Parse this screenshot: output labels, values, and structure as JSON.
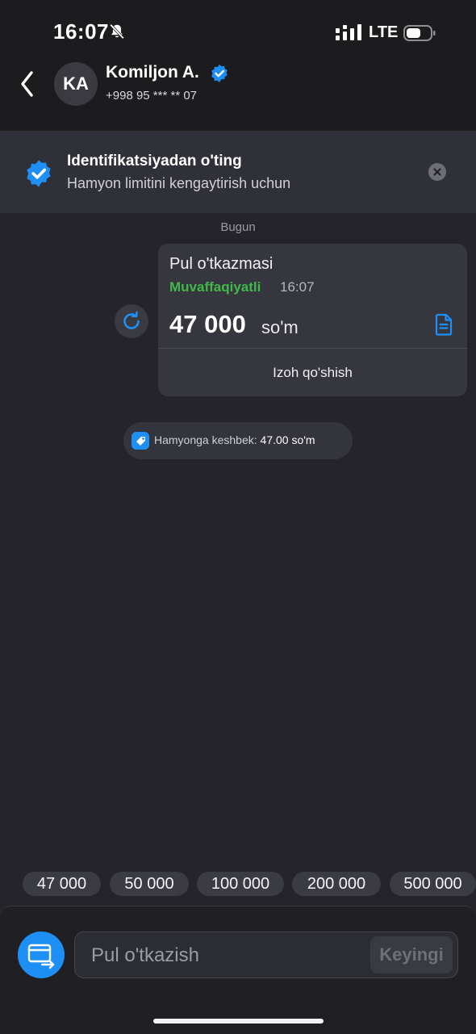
{
  "status_bar": {
    "time": "16:07",
    "network": "LTE",
    "icons": [
      "bell-off-icon",
      "signal-icon",
      "battery-icon"
    ]
  },
  "header": {
    "avatar_initials": "KA",
    "name": "Komiljon A.",
    "phone": "+998 95 *** ** 07",
    "icons": [
      "back-chevron-icon",
      "verified-badge-icon"
    ]
  },
  "banner": {
    "title": "Identifikatsiyadan o'ting",
    "subtitle": "Hamyon limitini kengaytirish uchun",
    "icons": [
      "verified-shield-icon",
      "close-icon"
    ]
  },
  "chat": {
    "date_separator": "Bugun",
    "transfer_card": {
      "title": "Pul o'tkazmasi",
      "status": "Muvaffaqiyatli",
      "time": "16:07",
      "amount": "47 000",
      "currency": "so'm",
      "comment_action": "Izoh qo'shish",
      "icons": [
        "repeat-icon",
        "receipt-icon"
      ]
    },
    "cashback": {
      "label": "Hamyonga keshbek:",
      "value": "47.00 so'm",
      "icon": "cashback-tag-icon"
    }
  },
  "quick_amounts": [
    "47 000",
    "50 000",
    "100 000",
    "200 000",
    "500 000"
  ],
  "composer": {
    "placeholder": "Pul o'tkazish",
    "value": "",
    "next_label": "Keyingi",
    "icon": "card-transfer-icon"
  },
  "colors": {
    "accent": "#1e8ff5",
    "success": "#41b84a",
    "background": "#24242a",
    "header_bg": "#1c1c1e"
  }
}
